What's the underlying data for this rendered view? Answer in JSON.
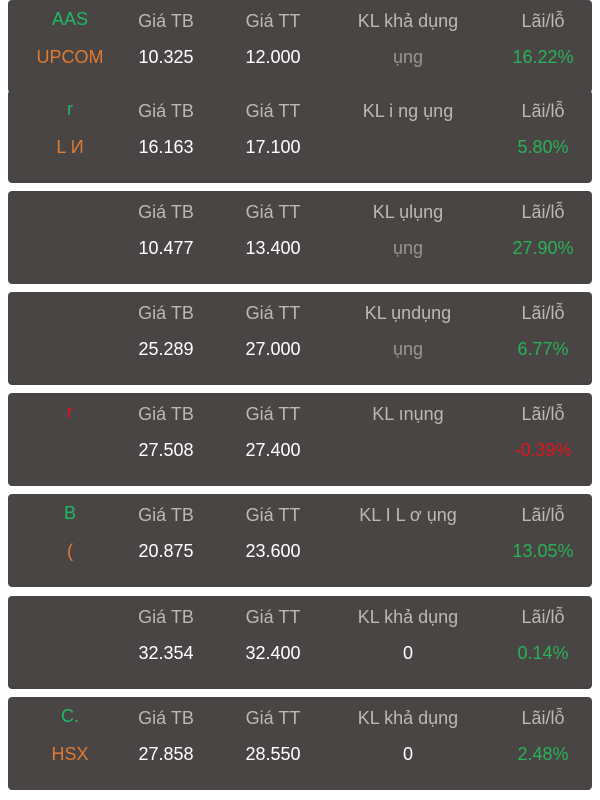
{
  "rows": [
    {
      "symbol": "AAS",
      "exchange": "UPCOM",
      "h_tb": "Giá TB",
      "h_tt": "Giá TT",
      "h_kl": "KL khả dụng",
      "h_pl": "Lãi/lỗ",
      "avg_price": "10.325",
      "cur_price": "12.000",
      "available": "ụng",
      "pl": "16.22%",
      "pl_sign": "pos"
    },
    {
      "symbol": "r",
      "exchange": "L     И",
      "h_tb": "Giá TB",
      "h_tt": "Giá TT",
      "h_kl": "KL i   ng ụng",
      "h_pl": "Lãi/lỗ",
      "avg_price": "16.163",
      "cur_price": "17.100",
      "available": "",
      "pl": "5.80%",
      "pl_sign": "pos"
    },
    {
      "symbol": "",
      "exchange": "",
      "h_tb": "Giá TB",
      "h_tt": "Giá TT",
      "h_kl": "KL       ụlụng",
      "h_pl": "Lãi/lỗ",
      "avg_price": "10.477",
      "cur_price": "13.400",
      "available": "ụng",
      "pl": "27.90%",
      "pl_sign": "pos"
    },
    {
      "symbol": "",
      "exchange": "",
      "h_tb": "Giá TB",
      "h_tt": "Giá TT",
      "h_kl": "KL    ụndụng",
      "h_pl": "Lãi/lỗ",
      "avg_price": "25.289",
      "cur_price": "27.000",
      "available": "ụng",
      "pl": "6.77%",
      "pl_sign": "pos"
    },
    {
      "symbol": "r",
      "exchange": "",
      "h_tb": "Giá TB",
      "h_tt": "Giá TT",
      "h_kl": "KL       ınụng",
      "h_pl": "Lãi/lỗ",
      "avg_price": "27.508",
      "cur_price": "27.400",
      "available": "",
      "pl": "-0.39%",
      "pl_sign": "neg"
    },
    {
      "symbol": "B",
      "exchange": "(",
      "h_tb": "Giá TB",
      "h_tt": "Giá TT",
      "h_kl": "KL I L  ơ ụng",
      "h_pl": "Lãi/lỗ",
      "avg_price": "20.875",
      "cur_price": "23.600",
      "available": "",
      "pl": "13.05%",
      "pl_sign": "pos"
    },
    {
      "symbol": "",
      "exchange": "",
      "h_tb": "Giá TB",
      "h_tt": "Giá TT",
      "h_kl": "KL khả dụng",
      "h_pl": "Lãi/lỗ",
      "avg_price": "32.354",
      "cur_price": "32.400",
      "available": "0",
      "pl": "0.14%",
      "pl_sign": "pos"
    },
    {
      "symbol": "C.",
      "exchange": "HSX",
      "h_tb": "Giá TB",
      "h_tt": "Giá TT",
      "h_kl": "KL khả dụng",
      "h_pl": "Lãi/lỗ",
      "avg_price": "27.858",
      "cur_price": "28.550",
      "available": "0",
      "pl": "2.48%",
      "pl_sign": "pos"
    }
  ]
}
